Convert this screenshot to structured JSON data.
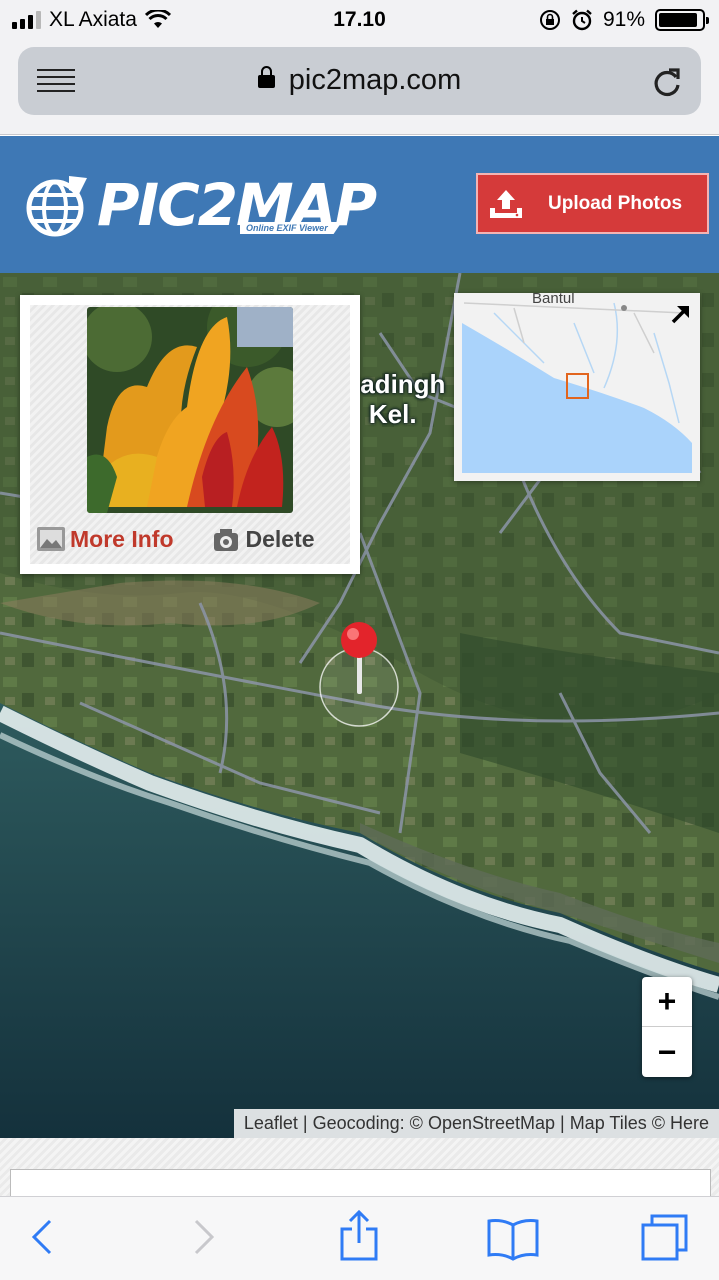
{
  "status": {
    "carrier": "XL Axiata",
    "time": "17.10",
    "battery": "91%",
    "battery_level": 0.91
  },
  "browser": {
    "url": "pic2map.com",
    "icons": [
      "menu-icon",
      "lock-icon",
      "reload-icon"
    ]
  },
  "header": {
    "logo_title": "PIC2MAP",
    "logo_subtitle": "Online EXIF Viewer",
    "upload_label": "Upload Photos",
    "header_color": "#3e78b5",
    "button_color": "#d53a3a"
  },
  "map": {
    "place_label_line1": "Gadingh",
    "place_label_line2": "Kel.",
    "minimap_label": "Bantul",
    "popup": {
      "more_info_label": "More Info",
      "delete_label": "Delete"
    },
    "zoom_in": "+",
    "zoom_out": "−",
    "attribution": "Leaflet | Geocoding: © OpenStreetMap | Map Tiles © Here",
    "pin_color": "#e3242b"
  },
  "toolbar": {
    "icons": [
      "back-icon",
      "forward-icon",
      "share-icon",
      "bookmarks-icon",
      "tabs-icon"
    ]
  }
}
